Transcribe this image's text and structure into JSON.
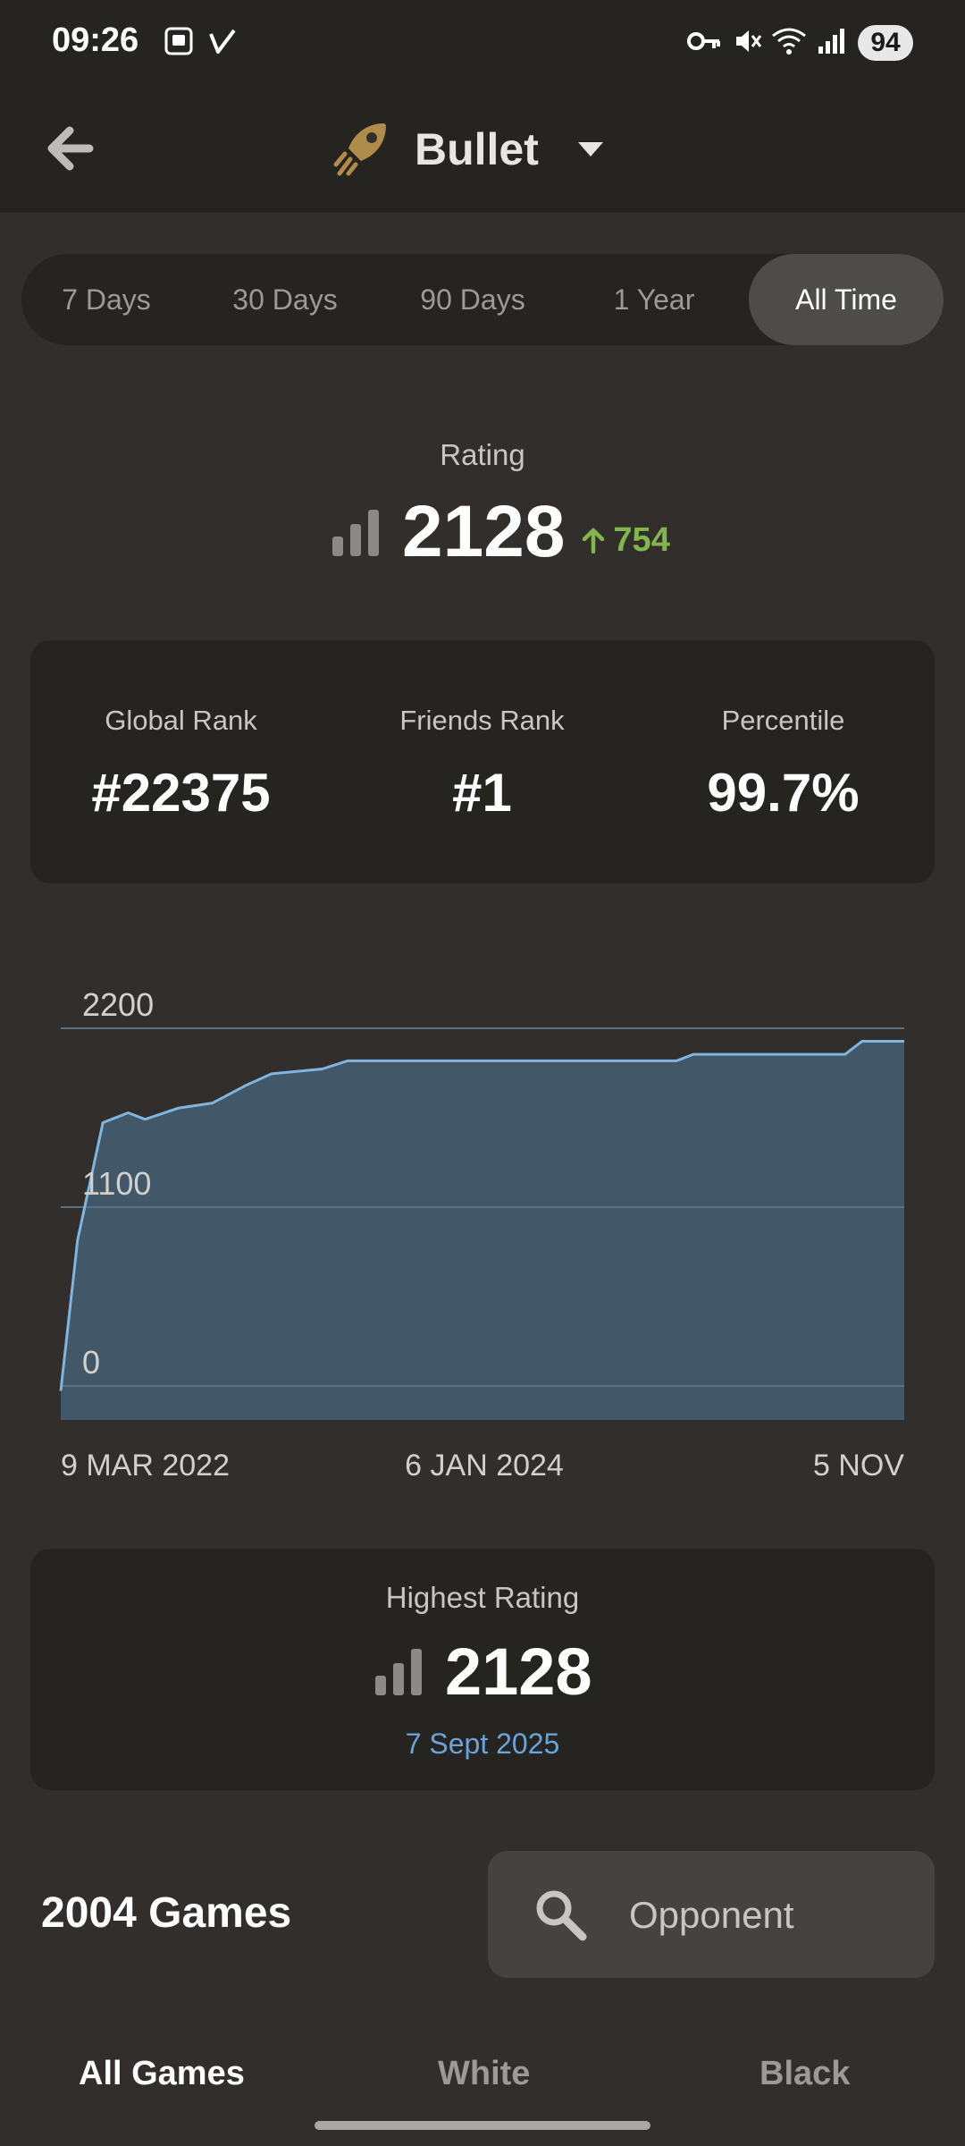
{
  "status_bar": {
    "time": "09:26",
    "battery": "94"
  },
  "header": {
    "title": "Bullet",
    "back_icon": "arrow-left-icon",
    "mode_icon": "bullet-icon"
  },
  "period_tabs": [
    {
      "label": "7 Days",
      "active": false
    },
    {
      "label": "30 Days",
      "active": false
    },
    {
      "label": "90 Days",
      "active": false
    },
    {
      "label": "1 Year",
      "active": false
    },
    {
      "label": "All Time",
      "active": true
    }
  ],
  "rating": {
    "label": "Rating",
    "value": "2128",
    "delta": "754"
  },
  "stats": [
    {
      "label": "Global Rank",
      "value": "#22375"
    },
    {
      "label": "Friends Rank",
      "value": "#1"
    },
    {
      "label": "Percentile",
      "value": "99.7%"
    }
  ],
  "chart_data": {
    "type": "area",
    "x_tick_labels": [
      "9 MAR 2022",
      "6 JAN 2024",
      "5 NOV"
    ],
    "y_ticks": [
      0,
      1100,
      2200
    ],
    "ylim": [
      0,
      2200
    ],
    "y_baseline": -180,
    "points": [
      [
        0.0,
        -30
      ],
      [
        0.02,
        900
      ],
      [
        0.05,
        1620
      ],
      [
        0.08,
        1680
      ],
      [
        0.1,
        1640
      ],
      [
        0.14,
        1710
      ],
      [
        0.18,
        1740
      ],
      [
        0.22,
        1850
      ],
      [
        0.25,
        1920
      ],
      [
        0.31,
        1950
      ],
      [
        0.34,
        2000
      ],
      [
        0.4,
        2000
      ],
      [
        0.6,
        2000
      ],
      [
        0.73,
        2000
      ],
      [
        0.75,
        2040
      ],
      [
        0.93,
        2040
      ],
      [
        0.95,
        2120
      ],
      [
        1.0,
        2120
      ]
    ],
    "colors": {
      "line": "#7fb5e0",
      "fill": "#435a6b",
      "grid": "#54636d"
    }
  },
  "highest_rating": {
    "label": "Highest Rating",
    "value": "2128",
    "date": "7 Sept 2025"
  },
  "games": {
    "count_label": "2004 Games",
    "search_label": "Opponent"
  },
  "bottom_tabs": [
    {
      "label": "All Games",
      "active": true
    },
    {
      "label": "White",
      "active": false
    },
    {
      "label": "Black",
      "active": false
    }
  ]
}
